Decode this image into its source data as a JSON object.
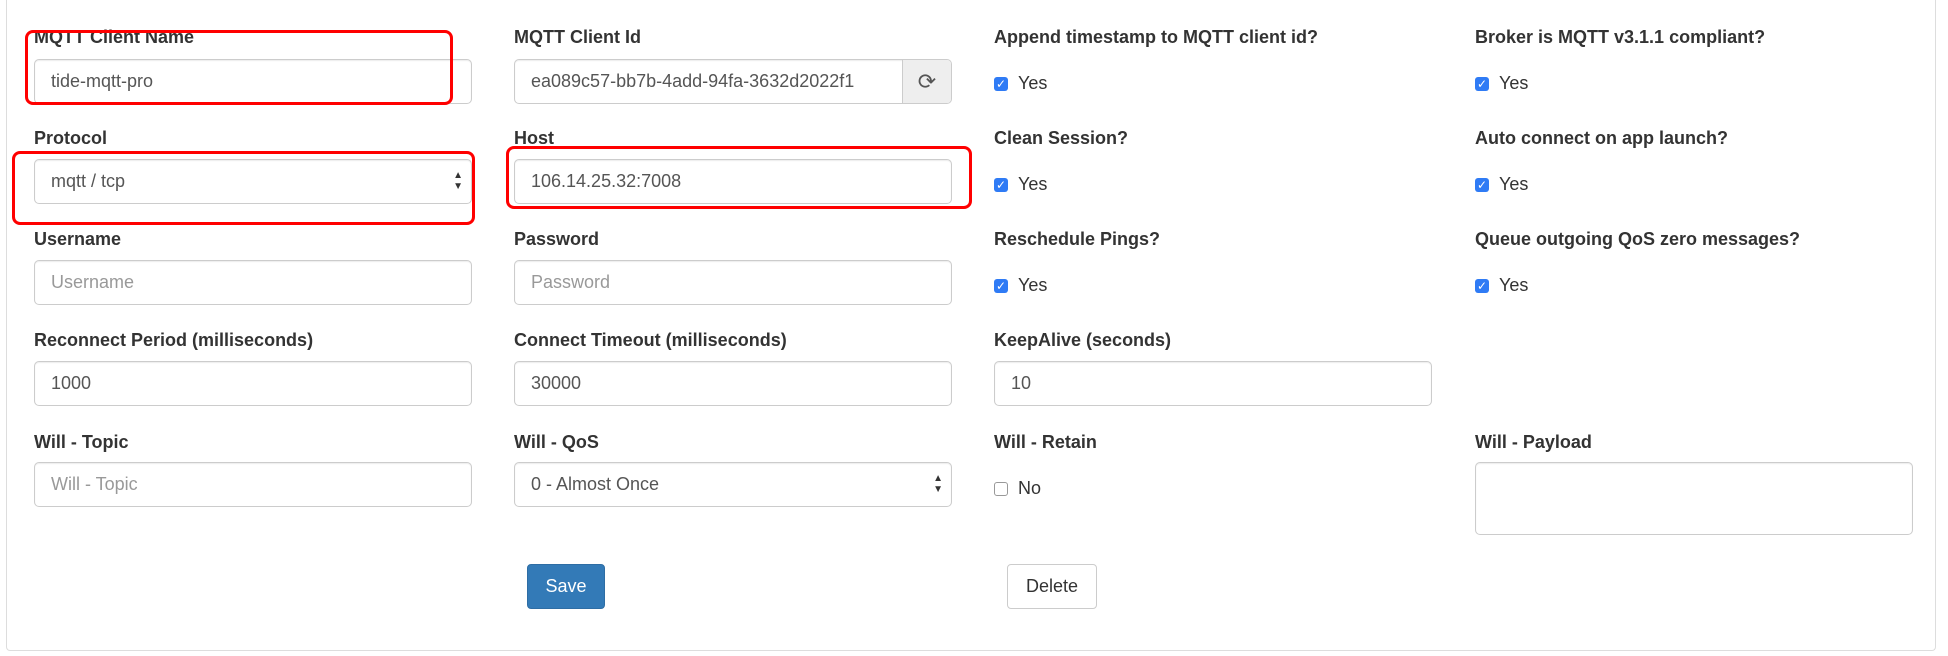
{
  "fields": {
    "client_name": {
      "label": "MQTT Client Name",
      "value": "tide-mqtt-pro"
    },
    "client_id": {
      "label": "MQTT Client Id",
      "value": "ea089c57-bb7b-4add-94fa-3632d2022f1",
      "refresh_icon": "refresh-icon"
    },
    "protocol": {
      "label": "Protocol",
      "value": "mqtt / tcp"
    },
    "host": {
      "label": "Host",
      "value": "106.14.25.32:7008"
    },
    "username": {
      "label": "Username",
      "placeholder": "Username"
    },
    "password": {
      "label": "Password",
      "placeholder": "Password"
    },
    "reconnect": {
      "label": "Reconnect Period (milliseconds)",
      "value": "1000"
    },
    "timeout": {
      "label": "Connect Timeout (milliseconds)",
      "value": "30000"
    },
    "keepalive": {
      "label": "KeepAlive (seconds)",
      "value": "10"
    },
    "will_topic": {
      "label": "Will - Topic",
      "placeholder": "Will - Topic"
    },
    "will_qos": {
      "label": "Will - QoS",
      "value": "0 - Almost Once"
    },
    "will_retain": {
      "label": "Will - Retain",
      "option": "No",
      "checked": false
    },
    "will_payload": {
      "label": "Will - Payload",
      "value": ""
    }
  },
  "checks": {
    "append_ts": {
      "label": "Append timestamp to MQTT client id?",
      "option": "Yes",
      "checked": true
    },
    "clean": {
      "label": "Clean Session?",
      "option": "Yes",
      "checked": true
    },
    "resched": {
      "label": "Reschedule Pings?",
      "option": "Yes",
      "checked": true
    },
    "v311": {
      "label": "Broker is MQTT v3.1.1 compliant?",
      "option": "Yes",
      "checked": true
    },
    "autoconnect": {
      "label": "Auto connect on app launch?",
      "option": "Yes",
      "checked": true
    },
    "queue": {
      "label": "Queue outgoing QoS zero messages?",
      "option": "Yes",
      "checked": true
    }
  },
  "buttons": {
    "save": "Save",
    "delete": "Delete"
  },
  "colors": {
    "primary": "#337ab7",
    "highlight": "#ff0000",
    "checkbox": "#2f7bf5"
  }
}
